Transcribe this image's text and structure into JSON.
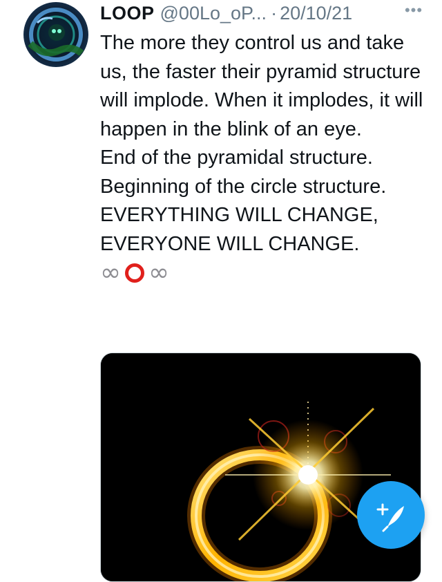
{
  "tweet": {
    "author_name": "LOOP",
    "handle": "@00Lo_oP...",
    "separator": "·",
    "date": "20/10/21",
    "more_label": "•••",
    "text_lines": [
      "The more they control us and take us, the faster their pyramid structure will implode. When it implodes, it will happen in the blink of an eye.",
      "End of the pyramidal structure. Beginning of the circle structure.",
      "EVERYTHING WILL CHANGE, EVERYONE WILL CHANGE."
    ],
    "symbols": {
      "infinity_left": "∞",
      "infinity_right": "∞",
      "ring_icon": "red-circle-icon"
    },
    "media_icon": "golden-ring-image"
  },
  "compose_button": {
    "icon": "feather-plus-icon"
  },
  "colors": {
    "accent": "#1da1f2",
    "text": "#0f1419",
    "muted": "#657786",
    "ring_red": "#e0201c"
  }
}
